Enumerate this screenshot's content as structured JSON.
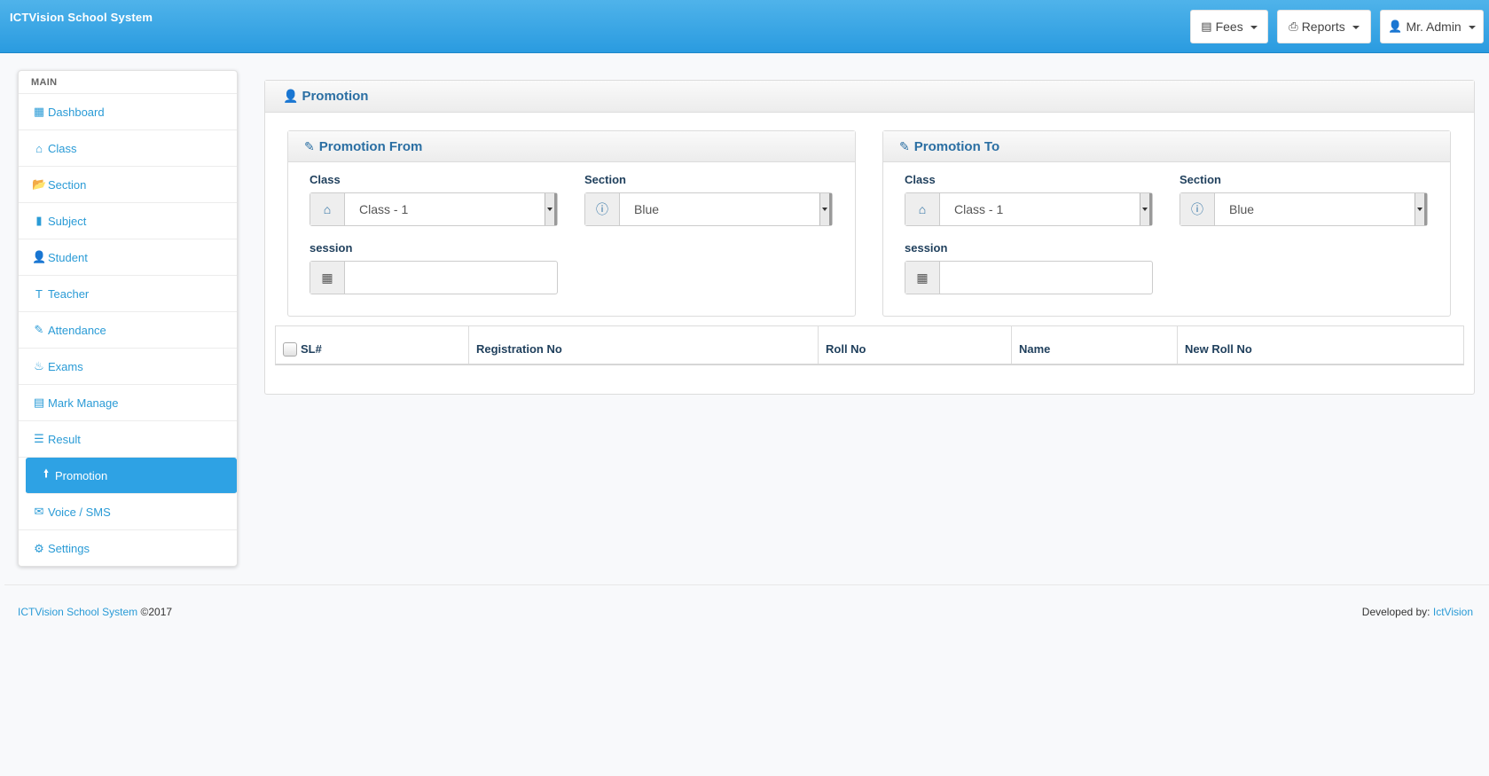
{
  "app": {
    "brand": "ICTVision School System"
  },
  "topnav": {
    "fees": {
      "label": "Fees",
      "icon": "list-alt-icon"
    },
    "reports": {
      "label": "Reports",
      "icon": "print-icon"
    },
    "admin": {
      "label": "Mr. Admin",
      "icon": "user-icon"
    }
  },
  "sidebar": {
    "heading": "MAIN",
    "items": [
      {
        "label": "Dashboard",
        "icon": "dashboard-icon"
      },
      {
        "label": "Class",
        "icon": "home-icon"
      },
      {
        "label": "Section",
        "icon": "folder-open-icon"
      },
      {
        "label": "Subject",
        "icon": "book-icon"
      },
      {
        "label": "Student",
        "icon": "user-icon"
      },
      {
        "label": "Teacher",
        "icon": "text-height-icon"
      },
      {
        "label": "Attendance",
        "icon": "pencil-icon"
      },
      {
        "label": "Exams",
        "icon": "fire-icon"
      },
      {
        "label": "Mark Manage",
        "icon": "list-alt-icon"
      },
      {
        "label": "Result",
        "icon": "list-icon"
      },
      {
        "label": "Promotion",
        "icon": "arrow-up-icon",
        "active": true
      },
      {
        "label": "Voice / SMS",
        "icon": "envelope-icon"
      },
      {
        "label": "Settings",
        "icon": "cog-icon"
      }
    ]
  },
  "main": {
    "title": "Promotion",
    "from": {
      "title": "Promotion From",
      "class_label": "Class",
      "class_value": "Class - 1",
      "section_label": "Section",
      "section_value": "Blue",
      "session_label": "session",
      "session_value": ""
    },
    "to": {
      "title": "Promotion To",
      "class_label": "Class",
      "class_value": "Class - 1",
      "section_label": "Section",
      "section_value": "Blue",
      "session_label": "session",
      "session_value": ""
    },
    "table": {
      "columns": [
        "SL#",
        "Registration No",
        "Roll No",
        "Name",
        "New Roll No"
      ],
      "rows": []
    }
  },
  "footer": {
    "brand_link": "ICTVision School System",
    "copyright": "©2017",
    "developed_by": "Developed by:",
    "developer_link": "IctVision"
  },
  "colors": {
    "navbar": "#2a9be0",
    "accent": "#2a9bd6",
    "active_item": "#2ea2e4",
    "heading_text": "#2b6fa3"
  }
}
